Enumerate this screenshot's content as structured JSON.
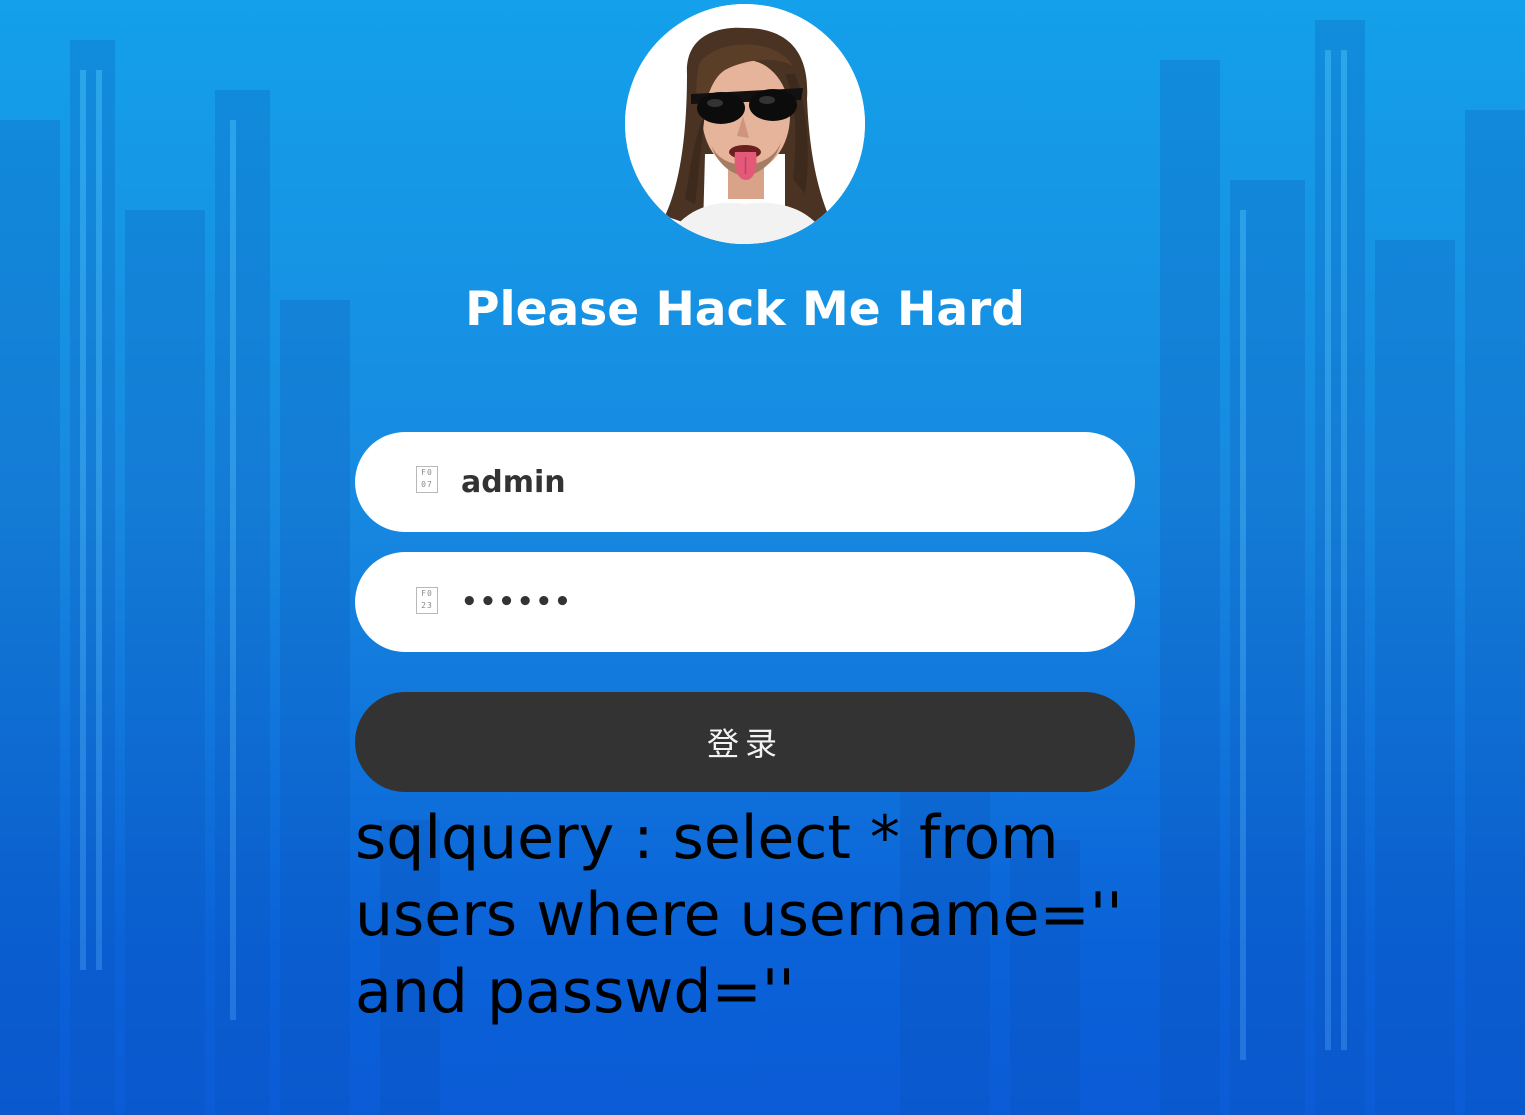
{
  "login": {
    "title": "Please Hack Me Hard",
    "username": {
      "icon": "user-icon",
      "icon_glyph": "F0\n07",
      "value": "admin"
    },
    "password": {
      "icon": "lock-icon",
      "icon_glyph": "F0\n23",
      "value": "••••••"
    },
    "submit_label": "登录",
    "sql_query": "sqlquery : select * from users where username='' and passwd=''"
  },
  "colors": {
    "background_top": "#14a0ea",
    "background_bottom": "#0b5bd6",
    "button": "#333333",
    "title": "#ffffff",
    "sql_text": "#000000"
  }
}
